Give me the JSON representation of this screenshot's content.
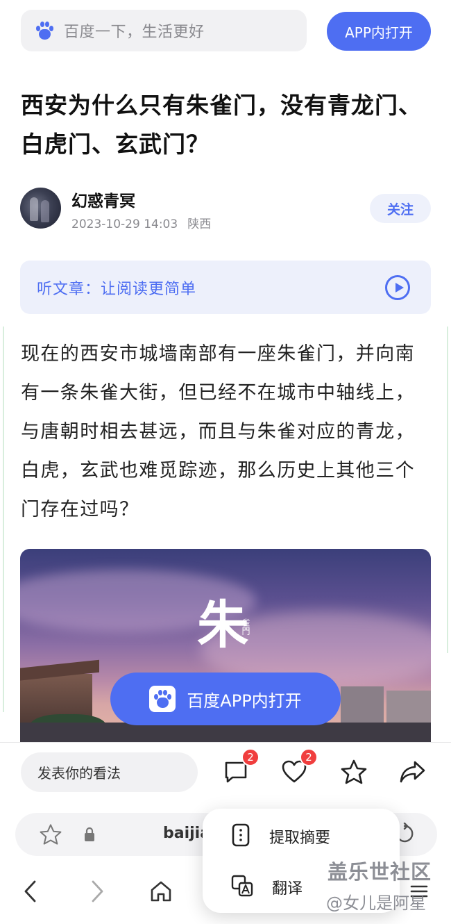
{
  "top_search": {
    "placeholder": "百度一下，生活更好"
  },
  "open_in_app_button": "APP内打开",
  "article": {
    "title": "西安为什么只有朱雀门，没有青龙门、白虎门、玄武门？",
    "author": {
      "name": "幻惑青冥",
      "date": "2023-10-29 14:03",
      "location": "陕西"
    },
    "follow_label": "关注",
    "listen_banner": "听文章：让阅读更简单",
    "paragraph": "现在的西安市城墙南部有一座朱雀门，并向南有一条朱雀大街，但已经不在城市中轴线上，与唐朝时相去甚远，而且与朱雀对应的青龙，白虎，玄武也难觅踪迹，那么历史上其他三个门存在过吗？",
    "image": {
      "calligraphy": "朱",
      "calligraphy_small": "雀門"
    },
    "image_overlay_button": "百度APP内打开"
  },
  "comment_bar": {
    "placeholder": "发表你的看法",
    "comment_count": "2",
    "like_count": "2"
  },
  "browser": {
    "url_fragment": "baijia"
  },
  "popup_menu": {
    "items": [
      {
        "label": "提取摘要",
        "icon": "summary-icon"
      },
      {
        "label": "翻译",
        "icon": "translate-icon"
      }
    ]
  },
  "watermark": {
    "site": "盖乐世社区",
    "user": "@女儿是阿星"
  },
  "colors": {
    "accent": "#4e6ef2",
    "badge": "#f03e3e",
    "banner_bg": "#edf0fb"
  }
}
